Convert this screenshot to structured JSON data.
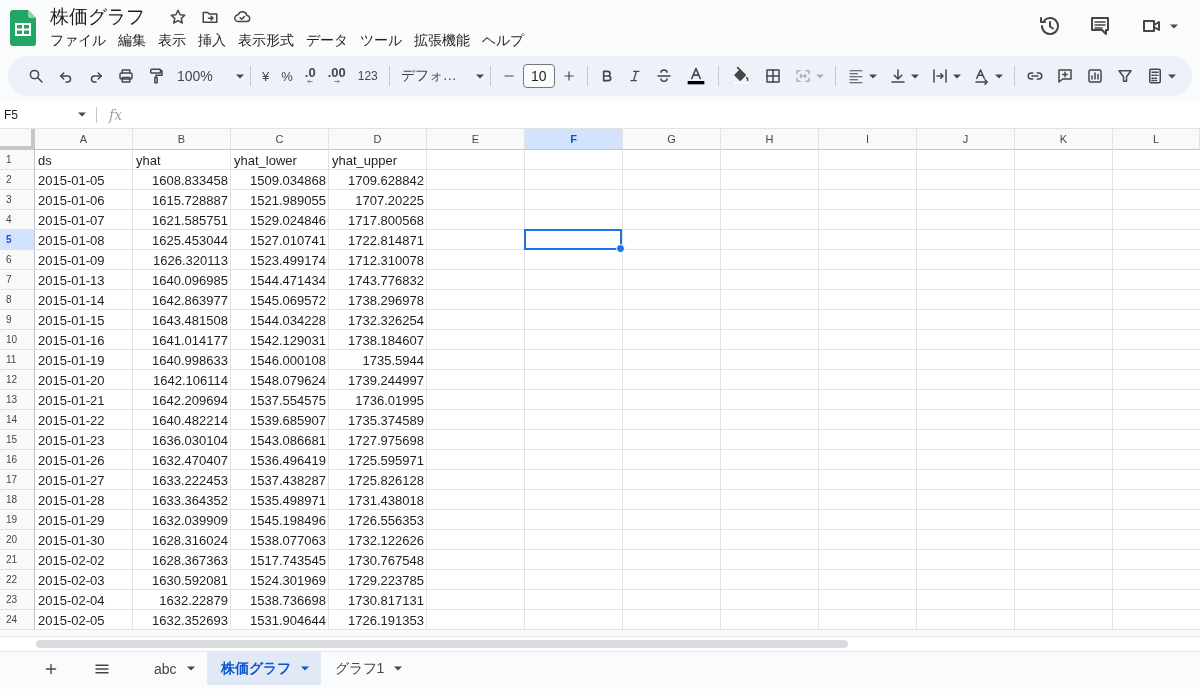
{
  "document": {
    "title": "株価グラフ"
  },
  "menu": [
    "ファイル",
    "編集",
    "表示",
    "挿入",
    "表示形式",
    "データ",
    "ツール",
    "拡張機能",
    "ヘルプ"
  ],
  "toolbar": {
    "zoom": "100%",
    "currency": "¥",
    "percent": "%",
    "decrease_decimal": ".0",
    "increase_decimal": ".00",
    "number_format": "123",
    "font": "デフォ…",
    "font_size": "10"
  },
  "formula_bar": {
    "name_box": "F5",
    "fx": "fx"
  },
  "columns": [
    {
      "label": "A",
      "selected": false
    },
    {
      "label": "B",
      "selected": false
    },
    {
      "label": "C",
      "selected": false
    },
    {
      "label": "D",
      "selected": false
    },
    {
      "label": "E",
      "selected": false
    },
    {
      "label": "F",
      "selected": true
    },
    {
      "label": "G",
      "selected": false
    },
    {
      "label": "H",
      "selected": false
    },
    {
      "label": "I",
      "selected": false
    },
    {
      "label": "J",
      "selected": false
    },
    {
      "label": "K",
      "selected": false
    },
    {
      "label": "L",
      "selected": false
    }
  ],
  "rows": [
    {
      "number": "1",
      "selected": false,
      "cells": [
        "ds",
        "yhat",
        "yhat_lower",
        "yhat_upper"
      ]
    },
    {
      "number": "2",
      "selected": false,
      "cells": [
        "2015-01-05",
        "1608.833458",
        "1509.034868",
        "1709.628842"
      ]
    },
    {
      "number": "3",
      "selected": false,
      "cells": [
        "2015-01-06",
        "1615.728887",
        "1521.989055",
        "1707.20225"
      ]
    },
    {
      "number": "4",
      "selected": false,
      "cells": [
        "2015-01-07",
        "1621.585751",
        "1529.024846",
        "1717.800568"
      ]
    },
    {
      "number": "5",
      "selected": true,
      "cells": [
        "2015-01-08",
        "1625.453044",
        "1527.010741",
        "1722.814871"
      ]
    },
    {
      "number": "6",
      "selected": false,
      "cells": [
        "2015-01-09",
        "1626.320113",
        "1523.499174",
        "1712.310078"
      ]
    },
    {
      "number": "7",
      "selected": false,
      "cells": [
        "2015-01-13",
        "1640.096985",
        "1544.471434",
        "1743.776832"
      ]
    },
    {
      "number": "8",
      "selected": false,
      "cells": [
        "2015-01-14",
        "1642.863977",
        "1545.069572",
        "1738.296978"
      ]
    },
    {
      "number": "9",
      "selected": false,
      "cells": [
        "2015-01-15",
        "1643.481508",
        "1544.034228",
        "1732.326254"
      ]
    },
    {
      "number": "10",
      "selected": false,
      "cells": [
        "2015-01-16",
        "1641.014177",
        "1542.129031",
        "1738.184607"
      ]
    },
    {
      "number": "11",
      "selected": false,
      "cells": [
        "2015-01-19",
        "1640.998633",
        "1546.000108",
        "1735.5944"
      ]
    },
    {
      "number": "12",
      "selected": false,
      "cells": [
        "2015-01-20",
        "1642.106114",
        "1548.079624",
        "1739.244997"
      ]
    },
    {
      "number": "13",
      "selected": false,
      "cells": [
        "2015-01-21",
        "1642.209694",
        "1537.554575",
        "1736.01995"
      ]
    },
    {
      "number": "14",
      "selected": false,
      "cells": [
        "2015-01-22",
        "1640.482214",
        "1539.685907",
        "1735.374589"
      ]
    },
    {
      "number": "15",
      "selected": false,
      "cells": [
        "2015-01-23",
        "1636.030104",
        "1543.086681",
        "1727.975698"
      ]
    },
    {
      "number": "16",
      "selected": false,
      "cells": [
        "2015-01-26",
        "1632.470407",
        "1536.496419",
        "1725.595971"
      ]
    },
    {
      "number": "17",
      "selected": false,
      "cells": [
        "2015-01-27",
        "1633.222453",
        "1537.438287",
        "1725.826128"
      ]
    },
    {
      "number": "18",
      "selected": false,
      "cells": [
        "2015-01-28",
        "1633.364352",
        "1535.498971",
        "1731.438018"
      ]
    },
    {
      "number": "19",
      "selected": false,
      "cells": [
        "2015-01-29",
        "1632.039909",
        "1545.198496",
        "1726.556353"
      ]
    },
    {
      "number": "20",
      "selected": false,
      "cells": [
        "2015-01-30",
        "1628.316024",
        "1538.077063",
        "1732.122626"
      ]
    },
    {
      "number": "21",
      "selected": false,
      "cells": [
        "2015-02-02",
        "1628.367363",
        "1517.743545",
        "1730.767548"
      ]
    },
    {
      "number": "22",
      "selected": false,
      "cells": [
        "2015-02-03",
        "1630.592081",
        "1524.301969",
        "1729.223785"
      ]
    },
    {
      "number": "23",
      "selected": false,
      "cells": [
        "2015-02-04",
        "1632.22879",
        "1538.736698",
        "1730.817131"
      ]
    },
    {
      "number": "24",
      "selected": false,
      "cells": [
        "2015-02-05",
        "1632.352693",
        "1531.904644",
        "1726.191353"
      ]
    }
  ],
  "sheet_tabs": [
    {
      "label": "abc",
      "selected": false
    },
    {
      "label": "株価グラフ",
      "selected": true
    },
    {
      "label": "グラフ1",
      "selected": false
    }
  ]
}
